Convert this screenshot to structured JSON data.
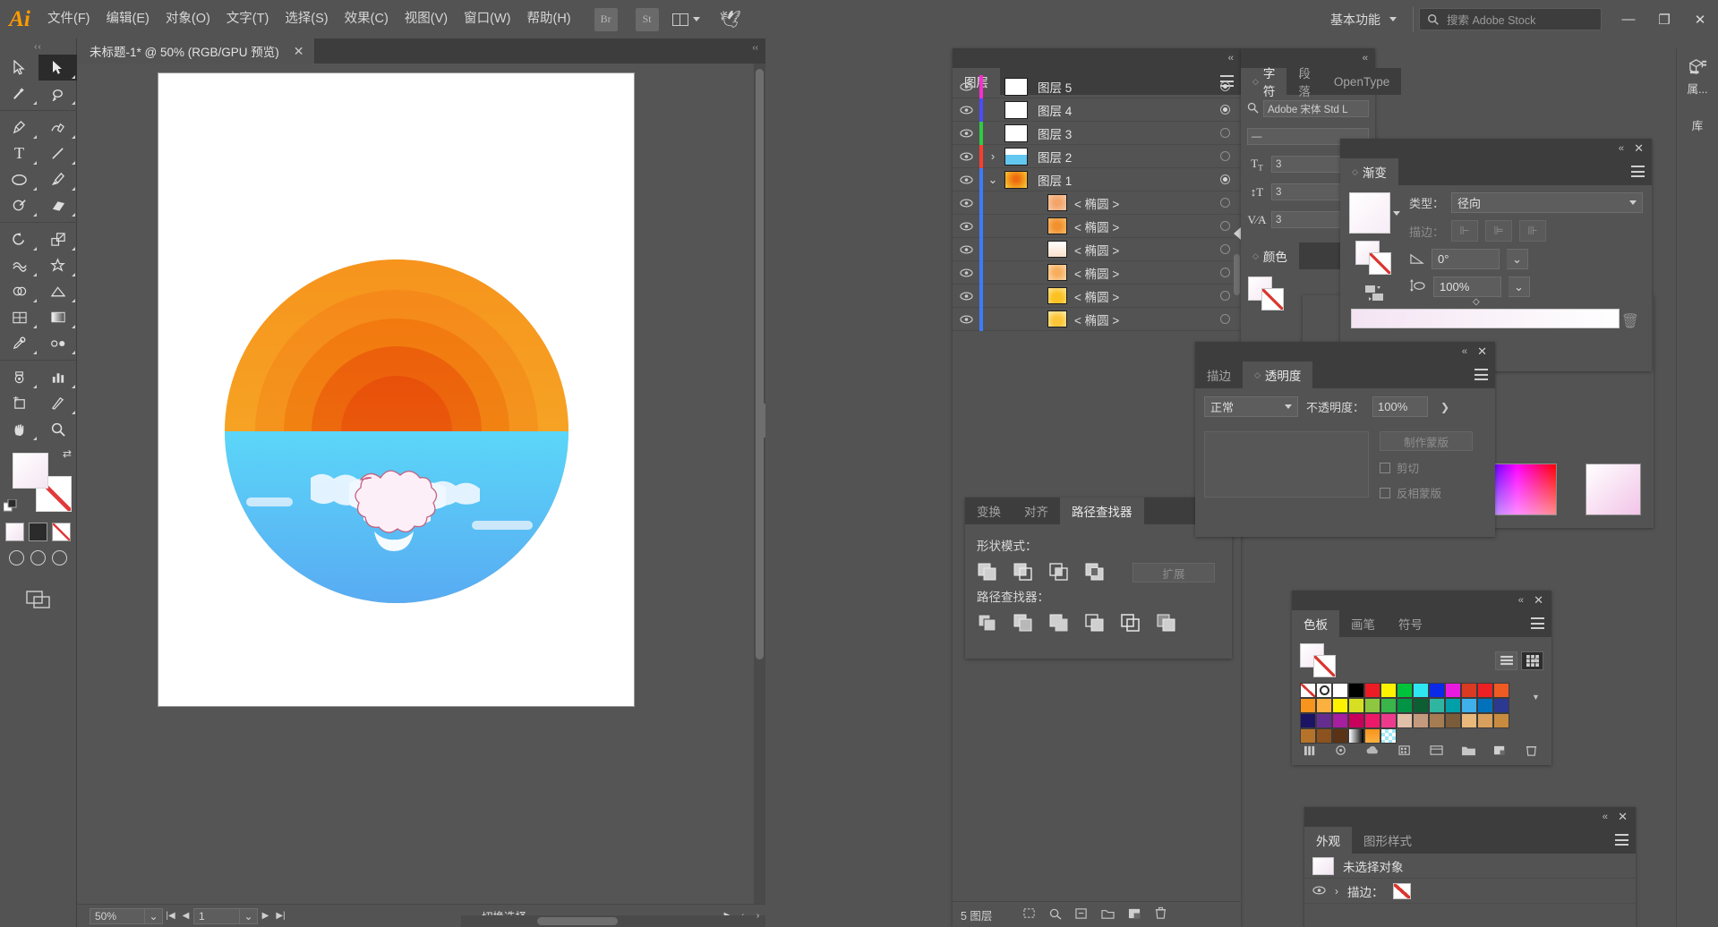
{
  "app": {
    "logo": "Ai",
    "menus": [
      "文件(F)",
      "编辑(E)",
      "对象(O)",
      "文字(T)",
      "选择(S)",
      "效果(C)",
      "视图(V)",
      "窗口(W)",
      "帮助(H)"
    ],
    "bridge_button": "Br",
    "stock_button": "St",
    "workspace": "基本功能",
    "search_placeholder": "搜索 Adobe Stock",
    "window_minimize": "—",
    "window_restore": "❐",
    "window_close": "✕"
  },
  "document": {
    "tab_title": "未标题-1* @ 50% (RGB/GPU 预览)",
    "tab_close": "✕"
  },
  "statusbar": {
    "zoom": "50%",
    "page": "1",
    "status_text": "切换选择"
  },
  "toolbar": {
    "tools": [
      {
        "name": "selection-tool",
        "glyph": "➤"
      },
      {
        "name": "direct-selection-tool",
        "glyph": "➤"
      },
      {
        "name": "magic-wand-tool",
        "glyph": "✦"
      },
      {
        "name": "lasso-tool",
        "glyph": "◠"
      },
      {
        "name": "pen-tool",
        "glyph": "✒"
      },
      {
        "name": "curvature-tool",
        "glyph": "✎"
      },
      {
        "name": "type-tool",
        "glyph": "T"
      },
      {
        "name": "line-segment-tool",
        "glyph": "╱"
      },
      {
        "name": "ellipse-tool",
        "glyph": "◯"
      },
      {
        "name": "paintbrush-tool",
        "glyph": "🖌"
      },
      {
        "name": "shaper-tool",
        "glyph": "◌"
      },
      {
        "name": "eraser-tool",
        "glyph": "◣"
      },
      {
        "name": "rotate-tool",
        "glyph": "↻"
      },
      {
        "name": "scale-tool",
        "glyph": "⤢"
      },
      {
        "name": "width-tool",
        "glyph": "≋"
      },
      {
        "name": "free-transform-tool",
        "glyph": "✜"
      },
      {
        "name": "shape-builder-tool",
        "glyph": "◎"
      },
      {
        "name": "perspective-grid-tool",
        "glyph": "▦"
      },
      {
        "name": "mesh-tool",
        "glyph": "⊞"
      },
      {
        "name": "gradient-tool",
        "glyph": "▤"
      },
      {
        "name": "eyedropper-tool",
        "glyph": "⚲"
      },
      {
        "name": "blend-tool",
        "glyph": "✧"
      },
      {
        "name": "symbol-sprayer-tool",
        "glyph": "⁙"
      },
      {
        "name": "column-graph-tool",
        "glyph": "▮"
      },
      {
        "name": "artboard-tool",
        "glyph": "⧉"
      },
      {
        "name": "slice-tool",
        "glyph": "✂"
      },
      {
        "name": "hand-tool",
        "glyph": "✋"
      },
      {
        "name": "zoom-tool",
        "glyph": "🔍"
      }
    ],
    "fill_color": "#ffffff",
    "stroke_color": "#ffffff"
  },
  "layers_panel": {
    "tab": "图层",
    "rows": [
      {
        "name": "图层 5",
        "indent": 0,
        "color": "#ff2bd0",
        "arrow": "",
        "thumb": "#ffffff",
        "target": "filled"
      },
      {
        "name": "图层 4",
        "indent": 0,
        "color": "#4b4bff",
        "arrow": "",
        "thumb": "#ffffff",
        "target": "filled"
      },
      {
        "name": "图层 3",
        "indent": 0,
        "color": "#2ecc40",
        "arrow": "",
        "thumb": "#ffffff",
        "target": "dim"
      },
      {
        "name": "图层 2",
        "indent": 0,
        "color": "#ff3b30",
        "arrow": "›",
        "thumb": "#6fd4f5",
        "target": "dim"
      },
      {
        "name": "图层 1",
        "indent": 0,
        "color": "#3b7bff",
        "arrow": "⌄",
        "thumb": "#f08a2e",
        "target": "filled"
      },
      {
        "name": "< 椭圆 >",
        "indent": 1,
        "color": "#3b7bff",
        "arrow": "",
        "thumb": "#f0a268",
        "target": "dim"
      },
      {
        "name": "< 椭圆 >",
        "indent": 1,
        "color": "#3b7bff",
        "arrow": "",
        "thumb": "#f2922f",
        "target": "dim"
      },
      {
        "name": "< 椭圆 >",
        "indent": 1,
        "color": "#3b7bff",
        "arrow": "",
        "thumb": "#fbe4d2",
        "target": "dim"
      },
      {
        "name": "< 椭圆 >",
        "indent": 1,
        "color": "#3b7bff",
        "arrow": "",
        "thumb": "#f7ad5c",
        "target": "dim"
      },
      {
        "name": "< 椭圆 >",
        "indent": 1,
        "color": "#3b7bff",
        "arrow": "",
        "thumb": "#fcc223",
        "target": "dim"
      },
      {
        "name": "< 椭圆 >",
        "indent": 1,
        "color": "#3b7bff",
        "arrow": "",
        "thumb": "#fcc63b",
        "target": "dim"
      }
    ],
    "footer_count": "5 图层"
  },
  "character_panel": {
    "tabs": [
      "字符",
      "段落",
      "OpenType"
    ],
    "font_family": "Adobe 宋体 Std L",
    "font_style": "—",
    "size_value": "3",
    "leading_value": "3",
    "tracking_value": "3",
    "color_tab": "颜色"
  },
  "rail": {
    "items": [
      "属...",
      "库"
    ]
  },
  "gradient_panel": {
    "title": "渐变",
    "type_label": "类型：",
    "type_value": "径向",
    "stroke_label": "描边：",
    "angle_value": "0°",
    "aspect_value": "100%"
  },
  "color_panel": {
    "tab": "颜色",
    "hex_label": "#",
    "hex_value": ""
  },
  "transparency_panel": {
    "tabs": [
      "描边",
      "透明度"
    ],
    "blend_mode": "正常",
    "opacity_label": "不透明度：",
    "opacity_value": "100%",
    "make_mask": "制作蒙版",
    "clip": "剪切",
    "invert_mask": "反相蒙版"
  },
  "pathfinder_panel": {
    "tabs": [
      "变换",
      "对齐",
      "路径查找器"
    ],
    "shape_modes_label": "形状模式：",
    "pathfinders_label": "路径查找器：",
    "expand_button": "扩展"
  },
  "swatches_panel": {
    "tabs": [
      "色板",
      "画笔",
      "符号"
    ],
    "colors_row1": [
      "none",
      "registration",
      "#ffffff",
      "#000000",
      "#ed1c24",
      "#fff200",
      "#00a651",
      "#00aeef",
      "#2e3192",
      "#ec008c",
      "#e04a2f",
      "#ed2024",
      "#f47b20",
      "#f7941e",
      "#fbb040"
    ],
    "colors_row2": [
      "#fff200",
      "#d7df23",
      "#8dc63f",
      "#39b54a",
      "#009444",
      "#006838",
      "#00a79d",
      "#00a79d",
      "#27aae1",
      "#0072bc",
      "#2b3990",
      "#1b1464",
      "#662d91",
      "#92278f",
      "#ed145b"
    ],
    "colors_row3": [
      "#ec008c",
      "#ee3a8c",
      "#d9b8a0",
      "#c49a7e",
      "#a67c52",
      "#7b5c3a",
      "#e8b97a",
      "#d8a05c",
      "#c98b3f",
      "#b5732a",
      "#8c5220",
      "#5a3316",
      "#gradient-bw",
      "#gradient-orange",
      "#pattern-cyan"
    ]
  },
  "appearance_panel": {
    "tabs": [
      "外观",
      "图形样式"
    ],
    "no_selection": "未选择对象",
    "stroke_label": "描边："
  },
  "artwork": {
    "description": "sunset-over-sea-illustration",
    "sun_rings": [
      "#f5a623",
      "#f59a1e",
      "#f07c10",
      "#ea5b0c",
      "#e5500a"
    ],
    "sea_colors": [
      "#5bd2f5",
      "#4ab8f2",
      "#4ea8f0"
    ],
    "cloud_color": "#ffffff",
    "reflection_color": "#fdeff8"
  }
}
